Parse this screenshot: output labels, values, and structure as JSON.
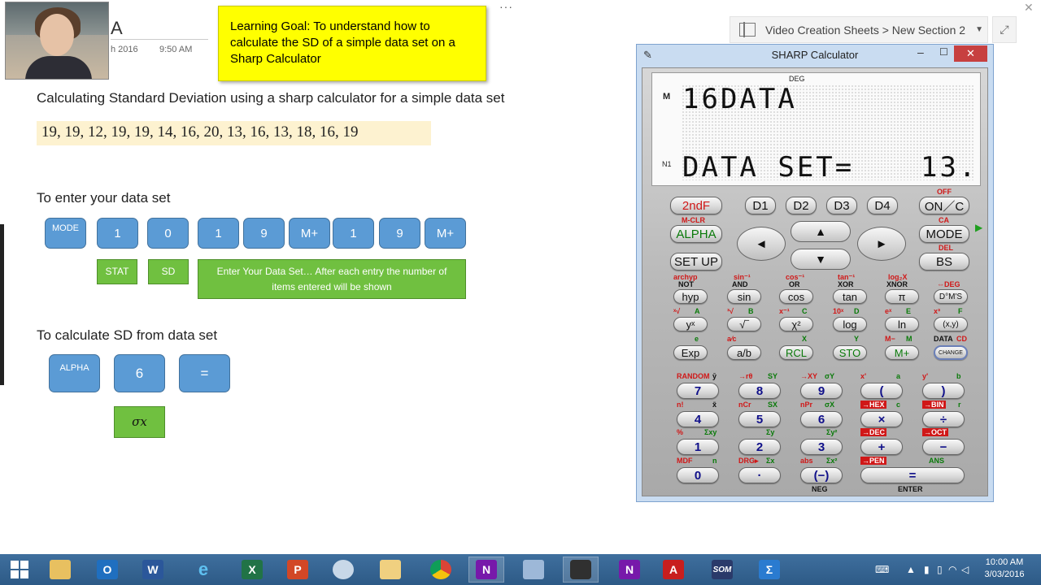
{
  "page": {
    "title_fragment": "A",
    "date_fragment": "h 2016",
    "time": "9:50 AM",
    "ellipsis": "···"
  },
  "learning_goal": "Learning Goal: To understand how to calculate the SD of a simple data set on a Sharp Calculator",
  "notes": {
    "heading": "Calculating Standard Deviation using a sharp calculator for a simple data set",
    "dataset": "19, 19, 12, 19, 19, 14, 16, 20, 13, 16, 13, 18, 16, 19",
    "enter_heading": "To enter your data set",
    "enter_keys": [
      "MODE",
      "1",
      "0",
      "1",
      "9",
      "M+",
      "1",
      "9",
      "M+"
    ],
    "stat_label": "STAT",
    "sd_label": "SD",
    "enter_note": "Enter Your Data Set… After each entry the number of items entered will be shown",
    "calc_heading": "To calculate SD from data set",
    "calc_keys": [
      "ALPHA",
      "6",
      "="
    ],
    "sigma_label": "σx"
  },
  "breadcrumb": {
    "text": "Video Creation Sheets > New Section 2",
    "chevron": "▼",
    "expand": "⤢",
    "close": "✕"
  },
  "calculator": {
    "title": "SHARP Calculator",
    "min": "–",
    "max": "☐",
    "close": "✕",
    "icon": "✎",
    "display": {
      "deg": "DEG",
      "m_flag": "M",
      "n_flag": "N1",
      "line1": "16DATA",
      "line2": "DATA SET=",
      "line2_value": "13."
    },
    "keys": {
      "second_f": "2ndF",
      "d1": "D1",
      "d2": "D2",
      "d3": "D3",
      "d4": "D4",
      "on_c": "ON／C",
      "alpha": "ALPHA",
      "mode": "MODE",
      "setup": "SET UP",
      "bs": "BS",
      "left": "◄",
      "right": "►",
      "up": "▲",
      "down": "▼",
      "hyp": "hyp",
      "sin": "sin",
      "cos": "cos",
      "tan": "tan",
      "pi": "π",
      "dms": "D°M'S",
      "yx": "yˣ",
      "sqrt": "√‾",
      "x2": "χ²",
      "log": "log",
      "ln": "ln",
      "xy": "(x,y)",
      "exp": "Exp",
      "frac": "a/b",
      "rcl": "RCL",
      "sto": "STO",
      "mplus": "M+",
      "change": "CHANGE",
      "n7": "7",
      "n8": "8",
      "n9": "9",
      "lparen": "(",
      "rparen": ")",
      "n4": "4",
      "n5": "5",
      "n6": "6",
      "mul": "×",
      "div": "÷",
      "n1": "1",
      "n2": "2",
      "n3": "3",
      "plus": "+",
      "minus": "−",
      "n0": "0",
      "dot": "·",
      "neg": "(−)",
      "equals": "="
    },
    "labels": {
      "off": "OFF",
      "mclr": "M-CLR",
      "ca": "CA",
      "del": "DEL",
      "archyp": "archyp",
      "not": "NOT",
      "sininv": "sin⁻¹",
      "and": "AND",
      "cosinv": "cos⁻¹",
      "or": "OR",
      "taninv": "tan⁻¹",
      "xor": "XOR",
      "logbx": "log₂X",
      "xnor": "XNOR",
      "todeg": "⇔DEG",
      "xroot": "ˣ√",
      "a": "A",
      "cbrt": "³√",
      "b": "B",
      "xinv": "x⁻¹",
      "c": "C",
      "tenx": "10ˣ",
      "d": "D",
      "ex": "eˣ",
      "e": "E",
      "x3": "x³",
      "f": "F",
      "e_small": "e",
      "abc": "a⁄c",
      "x": "X",
      "y": "Y",
      "mminus": "M−",
      "m": "M",
      "data": "DATA",
      "cd": "CD",
      "random": "RANDOM",
      "ybar": "ȳ",
      "rtheta": "→rθ",
      "sy": "SY",
      "toxy": "→XY",
      "sigmay": "σY",
      "xprime": "x'",
      "a_small": "a",
      "yprime": "y'",
      "b_small": "b",
      "nfact": "n!",
      "xbar": "x̄",
      "ncr": "nCr",
      "sx": "SX",
      "npr": "nPr",
      "sigmax": "σX",
      "tohex": "→HEX",
      "c_small": "c",
      "tobin": "→BIN",
      "r_small": "r",
      "pct": "%",
      "sxy": "Σxy",
      "sumy": "Σy",
      "sumy2": "Σy²",
      "todec": "→DEC",
      "tooct": "→OCT",
      "mdf": "MDF",
      "n_small": "n",
      "drg": "DRG▸",
      "sumx": "Σx",
      "abs": "abs",
      "sumx2": "Σx²",
      "topen": "→PEN",
      "ans": "ANS",
      "neg_lbl": "NEG",
      "enter_lbl": "ENTER"
    }
  },
  "taskbar": {
    "time": "10:00 AM",
    "date": "3/03/2016",
    "apps": [
      "start",
      "file-explorer",
      "outlook",
      "word",
      "internet-explorer",
      "excel",
      "powerpoint",
      "paint",
      "photos",
      "chrome",
      "onenote",
      "calculator",
      "sharp-calculator",
      "onenote-2",
      "acrobat",
      "som",
      "sigma"
    ]
  },
  "colors": {
    "goal_bg": "#ffff00",
    "key_blue": "#5b9bd5",
    "label_green": "#70c040",
    "dataset_bg": "#fdf2d0",
    "taskbar": "#2d5a86"
  }
}
